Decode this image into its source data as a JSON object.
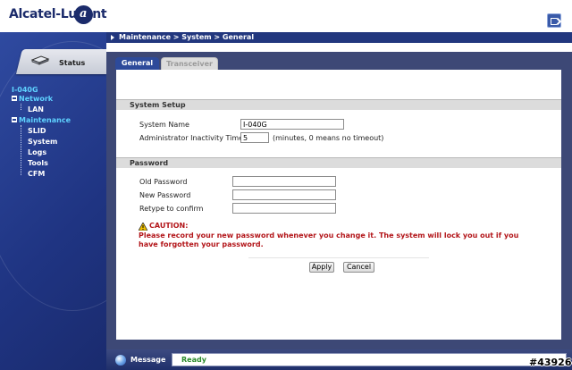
{
  "header": {
    "brand": "Alcatel-Lucent",
    "logo_glyph": "a",
    "logout_icon": "logout-icon"
  },
  "sidebar": {
    "status_label": "Status",
    "status_icon": "router-icon",
    "device": "I-040G",
    "items": [
      {
        "label": "Network",
        "expandable": true
      },
      {
        "label": "LAN"
      },
      {
        "label": "Maintenance",
        "expandable": true
      },
      {
        "label": "SLID"
      },
      {
        "label": "System"
      },
      {
        "label": "Logs"
      },
      {
        "label": "Tools"
      },
      {
        "label": "CFM"
      }
    ]
  },
  "breadcrumb": "Maintenance > System > General",
  "tabs": [
    {
      "label": "General",
      "active": true
    },
    {
      "label": "Transceiver",
      "active": false
    }
  ],
  "system_setup": {
    "title": "System Setup",
    "system_name_label": "System Name",
    "system_name_value": "I-040G",
    "timer_label": "Administrator Inactivity Timer",
    "timer_value": "5",
    "timer_hint": "(minutes, 0 means no timeout)"
  },
  "password": {
    "title": "Password",
    "old_label": "Old Password",
    "new_label": "New Password",
    "retype_label": "Retype to confirm",
    "old_value": "",
    "new_value": "",
    "retype_value": ""
  },
  "caution": {
    "title": "CAUTION:",
    "icon": "warning-icon",
    "text": "Please record your new password whenever you change it. The system will lock you out if you have forgotten your password."
  },
  "buttons": {
    "apply": "Apply",
    "cancel": "Cancel"
  },
  "status_bar": {
    "label": "Message",
    "message": "Ready",
    "icon": "globe-icon"
  },
  "watermark": "#43926",
  "colors": {
    "nav_blue": "#22377e",
    "accent_cyan": "#5fd2ff",
    "caution_red": "#b3161a",
    "ready_green": "#2a8a2a"
  }
}
